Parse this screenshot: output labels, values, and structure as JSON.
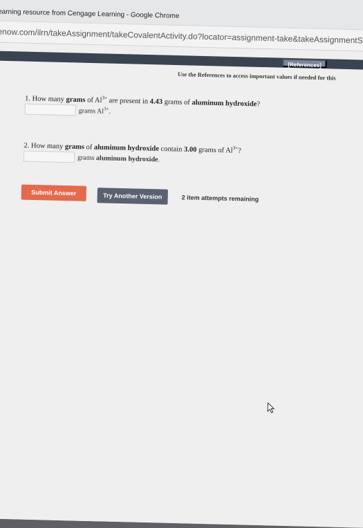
{
  "window": {
    "title": "earning resource from Cengage Learning - Google Chrome",
    "url": "enow.com/ilrn/takeAssignment/takeCovalentActivity.do?locator=assignment-take&takeAssignmentSessionLo"
  },
  "toolbar": {
    "references_label": "[References]",
    "references_note": "Use the References to access important values if needed for this"
  },
  "questions": [
    {
      "number": "1.",
      "text_a": "How many ",
      "bold_a": "grams",
      "text_b": " of Al",
      "sup_a": "3+",
      "text_c": " are present in ",
      "bold_b": "4.43",
      "text_d": " grams of ",
      "bold_c": "aluminum hydroxide",
      "text_e": "?",
      "unit_a": "grams Al",
      "unit_sup": "3+",
      "unit_b": ".",
      "input_value": ""
    },
    {
      "number": "2.",
      "text_a": "How many ",
      "bold_a": "grams",
      "text_b": " of ",
      "bold_b": "aluminum hydroxide",
      "text_c": " contain ",
      "bold_c": "3.00",
      "text_d": " grams of Al",
      "sup_a": "3+",
      "text_e": "?",
      "unit_a": "grams ",
      "unit_bold": "aluminum hydroxide",
      "unit_b": ".",
      "input_value": ""
    }
  ],
  "actions": {
    "submit_label": "Submit Answer",
    "try_label": "Try Another Version",
    "attempts_text": "2 item attempts remaining"
  },
  "colors": {
    "submit": "#e5694c",
    "try_another": "#5a6170",
    "header_band": "#3a4352"
  },
  "icons": {
    "cursor": "mouse-pointer-icon"
  }
}
